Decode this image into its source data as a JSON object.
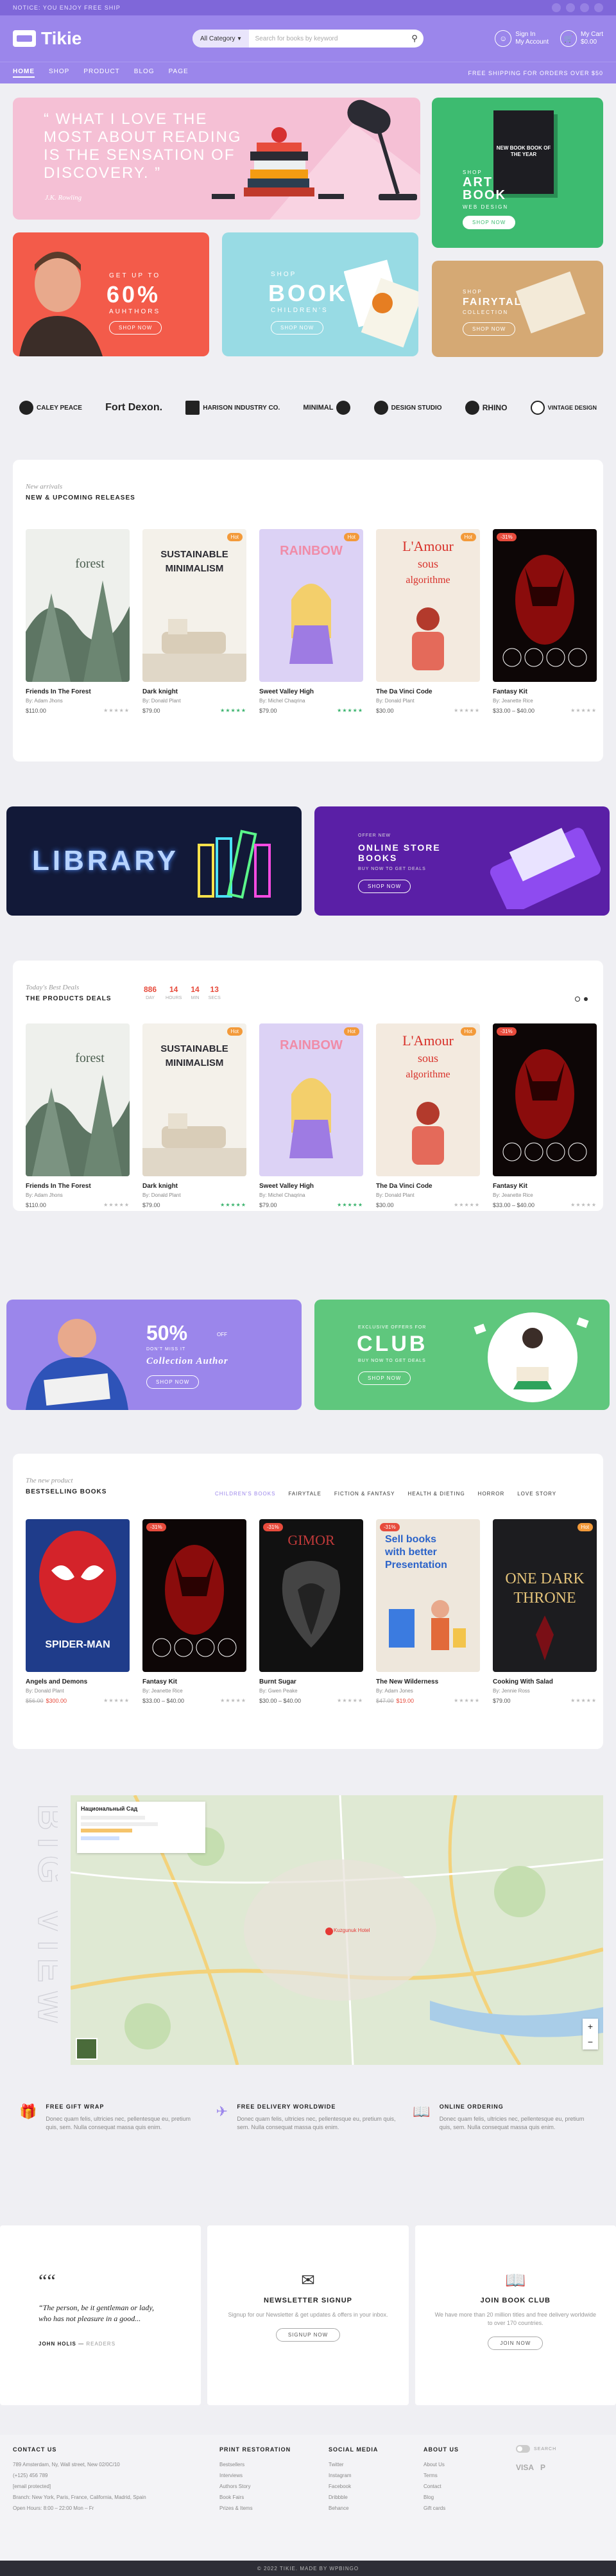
{
  "topbar": {
    "notice": "NOTICE: YOU ENJOY FREE SHIP",
    "social": [
      "f",
      "t",
      "i",
      "p"
    ]
  },
  "header": {
    "logo": "Tikie",
    "search": {
      "category": "All Category",
      "placeholder": "Search for books by keyword"
    },
    "signin": {
      "line1": "Sign In",
      "line2": "My Account"
    },
    "cart": {
      "line1": "My Cart",
      "line2": "$0.00"
    }
  },
  "nav": {
    "items": [
      "HOME",
      "SHOP",
      "PRODUCT",
      "BLOG",
      "PAGE"
    ],
    "ship": "FREE SHIPPING FOR ORDERS OVER $50"
  },
  "hero": {
    "quote": "“ WHAT I LOVE THE MOST ABOUT READING IS THE SENSATION OF DISCOVERY. ”",
    "quote_author": "J.K. Rowling",
    "art": {
      "pre": "SHOP",
      "title": "ART BOOK",
      "sub": "WEB DESIGN",
      "btn": "SHOP NOW",
      "book_title": "NEW BOOK BOOK OF THE YEAR"
    },
    "sixty": {
      "pre": "GET UP TO",
      "big": "60%",
      "sub": "AUHTHORS",
      "btn": "SHOP NOW"
    },
    "kids": {
      "pre": "SHOP",
      "big": "BOOK",
      "sub": "CHILDREN'S",
      "btn": "SHOP NOW"
    },
    "fairy": {
      "pre": "SHOP",
      "big": "FAIRYTALE",
      "sub": "COLLECTION",
      "btn": "SHOP NOW"
    }
  },
  "brands": [
    "CALEY PEACE",
    "Fort Dexon.",
    "HARISON INDUSTRY CO.",
    "MINIMAL",
    "DESIGN STUDIO",
    "RHINO",
    "VINTAGE DESIGN"
  ],
  "new_releases": {
    "sub": "New arrivals",
    "title": "NEW & UPCOMING RELEASES",
    "products": [
      {
        "name": "Friends In The Forest",
        "author": "By: Adam Jhons",
        "price": "$110.00",
        "tag": "",
        "cover": "forest"
      },
      {
        "name": "Dark knight",
        "author": "By: Donald Plant",
        "price": "$79.00",
        "tag": "Hot",
        "cover": "minimal"
      },
      {
        "name": "Sweet Valley High",
        "author": "By: Michel Chaqrina",
        "price": "$79.00",
        "tag": "Hot",
        "cover": "rainbow"
      },
      {
        "name": "The Da Vinci Code",
        "author": "By: Donald Plant",
        "price": "$30.00",
        "tag": "Hot",
        "cover": "amour"
      },
      {
        "name": "Fantasy Kit",
        "author": "By: Jeanette Rice",
        "price": "$33.00 – $40.00",
        "tag": "-31%",
        "cover": "batman"
      }
    ]
  },
  "banners1": {
    "library": "LIBRARY",
    "online_pre": "OFFER NEW",
    "online_title": "ONLINE STORE BOOKS",
    "online_sub": "BUY NOW TO GET DEALS",
    "online_btn": "SHOP NOW"
  },
  "deals": {
    "sub": "Today's Best Deals",
    "title": "THE PRODUCTS DEALS",
    "countdown": [
      {
        "n": "886",
        "l": "DAY"
      },
      {
        "n": "14",
        "l": "HOURS"
      },
      {
        "n": "14",
        "l": "MIN"
      },
      {
        "n": "13",
        "l": "SECS"
      }
    ],
    "products": [
      {
        "name": "Friends In The Forest",
        "author": "By: Adam Jhons",
        "price": "$110.00",
        "tag": "",
        "cover": "forest"
      },
      {
        "name": "Dark knight",
        "author": "By: Donald Plant",
        "price": "$79.00",
        "tag": "Hot",
        "cover": "minimal"
      },
      {
        "name": "Sweet Valley High",
        "author": "By: Michel Chaqrina",
        "price": "$79.00",
        "tag": "Hot",
        "cover": "rainbow"
      },
      {
        "name": "The Da Vinci Code",
        "author": "By: Donald Plant",
        "price": "$30.00",
        "tag": "Hot",
        "cover": "amour"
      },
      {
        "name": "Fantasy Kit",
        "author": "By: Jeanette Rice",
        "price": "$33.00 – $40.00",
        "tag": "-31%",
        "cover": "batman"
      }
    ]
  },
  "banners2": {
    "fifty": "50%",
    "fifty_off": "OFF",
    "fifty_sub": "DON'T MISS IT",
    "fifty_title": "Collection Author",
    "fifty_btn": "SHOP NOW",
    "club_pre": "EXCLUSIVE OFFERS FOR",
    "club": "CLUB",
    "club_sub": "BUY NOW TO GET DEALS",
    "club_btn": "SHOP NOW"
  },
  "bestselling": {
    "sub": "The new product",
    "title": "BESTSELLING BOOKS",
    "tabs": [
      "CHILDREN'S BOOKS",
      "FAIRYTALE",
      "FICTION & FANTASY",
      "HEALTH & DIETING",
      "HORROR",
      "LOVE STORY"
    ],
    "products": [
      {
        "name": "Angels and Demons",
        "author": "By: Donald Plant",
        "old": "$56.00",
        "price": "$300.00",
        "tag": "",
        "cover": "spiderman"
      },
      {
        "name": "Fantasy Kit",
        "author": "By: Jeanette Rice",
        "old": "",
        "price": "$33.00 – $40.00",
        "tag": "-31%",
        "cover": "batman"
      },
      {
        "name": "Burnt Sugar",
        "author": "By: Gwen Peake",
        "old": "",
        "price": "$30.00 – $40.00",
        "tag": "-31%",
        "cover": "gimor"
      },
      {
        "name": "The New Wilderness",
        "author": "By: Adam Jones",
        "old": "$47.00",
        "price": "$19.00",
        "tag": "-31%",
        "cover": "sellbooks"
      },
      {
        "name": "Cooking With Salad",
        "author": "By: Jennie Ross",
        "old": "",
        "price": "$79.00",
        "tag": "Hot",
        "cover": "throne"
      }
    ]
  },
  "map": {
    "label": "BIG VIEW",
    "place": "Kuzgunuk Hotel",
    "card_title": "Национальный Сад"
  },
  "features": [
    {
      "title": "FREE GIFT WRAP",
      "desc": "Donec quam felis, ultricies nec, pellentesque eu, pretium quis, sem. Nulla consequat massa quis enim."
    },
    {
      "title": "FREE DELIVERY WORLDWIDE",
      "desc": "Donec quam felis, ultricies nec, pellentesque eu, pretium quis, sem. Nulla consequat massa quis enim."
    },
    {
      "title": "ONLINE ORDERING",
      "desc": "Donec quam felis, ultricies nec, pellentesque eu, pretium quis, sem. Nulla consequat massa quis enim."
    }
  ],
  "testimonial": {
    "quote": "“The person, be it gentleman or lady, who has not pleasure in a good...",
    "author": "JOHN HOLIS",
    "role": "READERS"
  },
  "newsletter": {
    "title": "NEWSLETTER SIGNUP",
    "desc": "Signup for our Newsletter & get updates & offers in your inbox.",
    "btn": "SIGNUP NOW"
  },
  "club": {
    "title": "JOIN BOOK CLUB",
    "desc": "We have more than 20 million titles and free delivery worldwide to over 170 countries.",
    "btn": "JOIN NOW"
  },
  "footer": {
    "contact": {
      "title": "CONTACT US",
      "items": [
        "789 Amsterdam, Ny, Wall street, New 02/0C/10",
        "(+125) 456 789",
        "[email protected]",
        "Branch: New York, Paris, France, California, Madrid, Spain",
        "Open Hours: 8:00 – 22:00 Mon – Fr"
      ]
    },
    "print": {
      "title": "PRINT RESTORATION",
      "items": [
        "Bestsellers",
        "Interviews",
        "Authors Story",
        "Book Fairs",
        "Prizes & Items"
      ]
    },
    "social": {
      "title": "SOCIAL MEDIA",
      "items": [
        "Twitter",
        "Instagram",
        "Facebook",
        "Dribbble",
        "Behance"
      ]
    },
    "about": {
      "title": "ABOUT US",
      "items": [
        "About Us",
        "Terms",
        "Contact",
        "Blog",
        "Gift cards"
      ]
    },
    "payments": [
      "VISA",
      "P"
    ],
    "toggle": "SEARCH"
  },
  "copyright": "© 2022 TIKIE. MADE BY WPBINGO"
}
